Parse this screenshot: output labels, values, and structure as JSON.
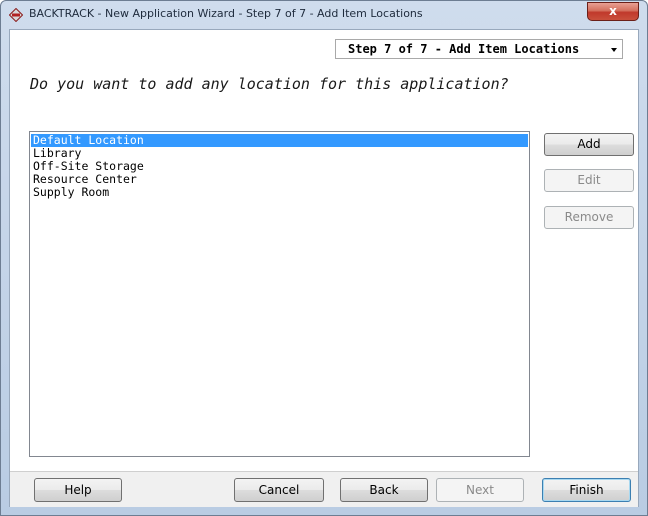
{
  "window": {
    "title": "BACKTRACK - New Application Wizard - Step 7 of 7 - Add Item Locations",
    "close_label": "x"
  },
  "step_select": {
    "value": "Step 7 of 7 - Add Item Locations"
  },
  "question": "Do you want to add any location for this application?",
  "locations": {
    "items": [
      "Default Location",
      "Library",
      "Off-Site Storage",
      "Resource Center",
      "Supply Room"
    ],
    "selected_index": 0
  },
  "side_buttons": {
    "add": "Add",
    "edit": "Edit",
    "remove": "Remove"
  },
  "footer": {
    "help": "Help",
    "cancel": "Cancel",
    "back": "Back",
    "next": "Next",
    "finish": "Finish"
  },
  "colors": {
    "selection": "#3399ff",
    "title_gradient": "#cfdced",
    "close": "#c0392b"
  },
  "icons": {
    "app": "backtrack-app-icon",
    "close": "close-icon",
    "dropdown": "chevron-down-icon"
  }
}
